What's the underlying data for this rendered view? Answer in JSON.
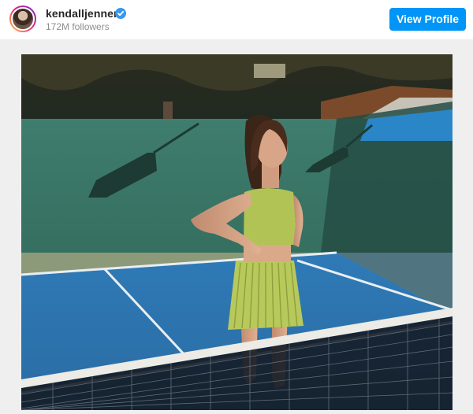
{
  "profile": {
    "username": "kendalljenner",
    "followers": "172M followers",
    "verified": true,
    "view_profile_label": "View Profile"
  },
  "colors": {
    "accent": "#0095f6",
    "verified_badge": "#3897f0",
    "court_blue": "#2f78b6",
    "court_wall": "#3d7c6c",
    "outfit": "#b7c85a"
  },
  "icons": {
    "avatar": "profile-photo",
    "verified": "verified-badge-icon"
  },
  "post": {
    "image_subject": "photo"
  }
}
